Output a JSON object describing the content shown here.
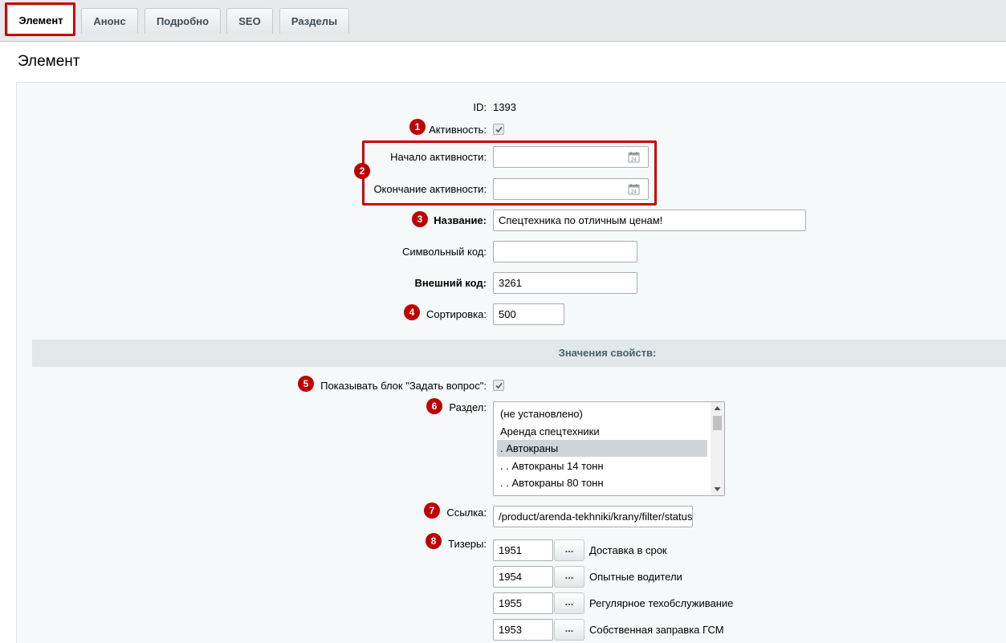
{
  "tabs": [
    {
      "label": "Элемент"
    },
    {
      "label": "Анонс"
    },
    {
      "label": "Подробно"
    },
    {
      "label": "SEO"
    },
    {
      "label": "Разделы"
    }
  ],
  "panel": {
    "title": "Элемент"
  },
  "fields": {
    "id": {
      "label": "ID:",
      "value": "1393"
    },
    "active": {
      "label": "Активность:",
      "checked": true
    },
    "active_from": {
      "label": "Начало активности:",
      "value": ""
    },
    "active_to": {
      "label": "Окончание активности:",
      "value": ""
    },
    "name": {
      "label": "Название:",
      "value": "Спецтехника по отличным ценам!"
    },
    "code": {
      "label": "Символьный код:",
      "value": ""
    },
    "xml_id": {
      "label": "Внешний код:",
      "value": "3261"
    },
    "sort": {
      "label": "Сортировка:",
      "value": "500"
    }
  },
  "properties": {
    "title": "Значения свойств:",
    "show_question": {
      "label": "Показывать блок \"Задать вопрос\":",
      "checked": true
    },
    "section": {
      "label": "Раздел:",
      "options": [
        "(не установлено)",
        "Аренда спецтехники",
        ". Автокраны",
        ". . Автокраны 14 тонн",
        ". . Автокраны 80 тонн"
      ],
      "selected_index": 2
    },
    "link": {
      "label": "Ссылка:",
      "value": "/product/arenda-tekhniki/krany/filter/status"
    },
    "teasers": {
      "label": "Тизеры:",
      "button_label": "...",
      "items": [
        {
          "id": "1951",
          "name": "Доставка в срок"
        },
        {
          "id": "1954",
          "name": "Опытные водители"
        },
        {
          "id": "1955",
          "name": "Регулярное техобслуживание"
        },
        {
          "id": "1953",
          "name": "Собственная заправка ГСМ"
        }
      ]
    }
  },
  "badges": [
    "1",
    "2",
    "3",
    "4",
    "5",
    "6",
    "7",
    "8"
  ],
  "colors": {
    "accent_red": "#c00000",
    "panel_bg": "#f5f9f9",
    "section_bg": "#e0e8ea"
  }
}
